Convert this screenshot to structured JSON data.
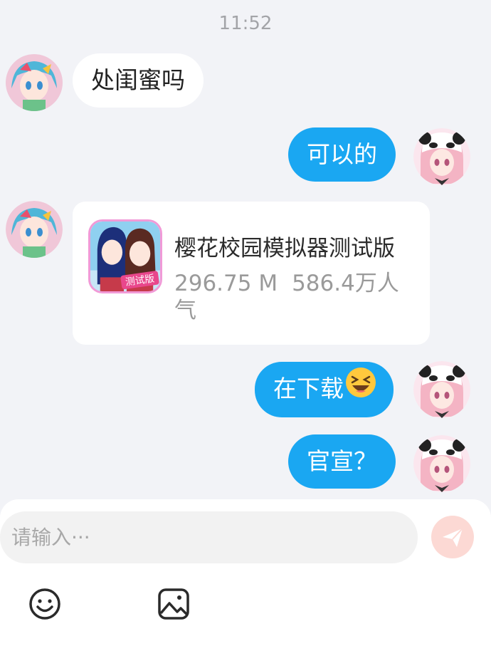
{
  "time": "11:52",
  "messages": [
    {
      "side": "in",
      "text": "处闺蜜吗"
    },
    {
      "side": "out",
      "text": "可以的"
    },
    {
      "side": "out",
      "text": "在下载"
    },
    {
      "side": "out",
      "text": "官宣？"
    }
  ],
  "app_card": {
    "name": "樱花校园模拟器测试版",
    "size": "296.75 M",
    "popularity": "586.4万人气",
    "badge": "测试版"
  },
  "input": {
    "placeholder": "请输入···"
  },
  "icons": {
    "send": "send-icon",
    "emoji": "emoji-icon",
    "image": "image-icon",
    "inline_emoji": "grinning-squint-emoji"
  },
  "colors": {
    "background": "#f2f3f7",
    "outgoing_bubble": "#1aa7f2",
    "incoming_bubble": "#ffffff",
    "send_button": "#fcd9d4"
  }
}
